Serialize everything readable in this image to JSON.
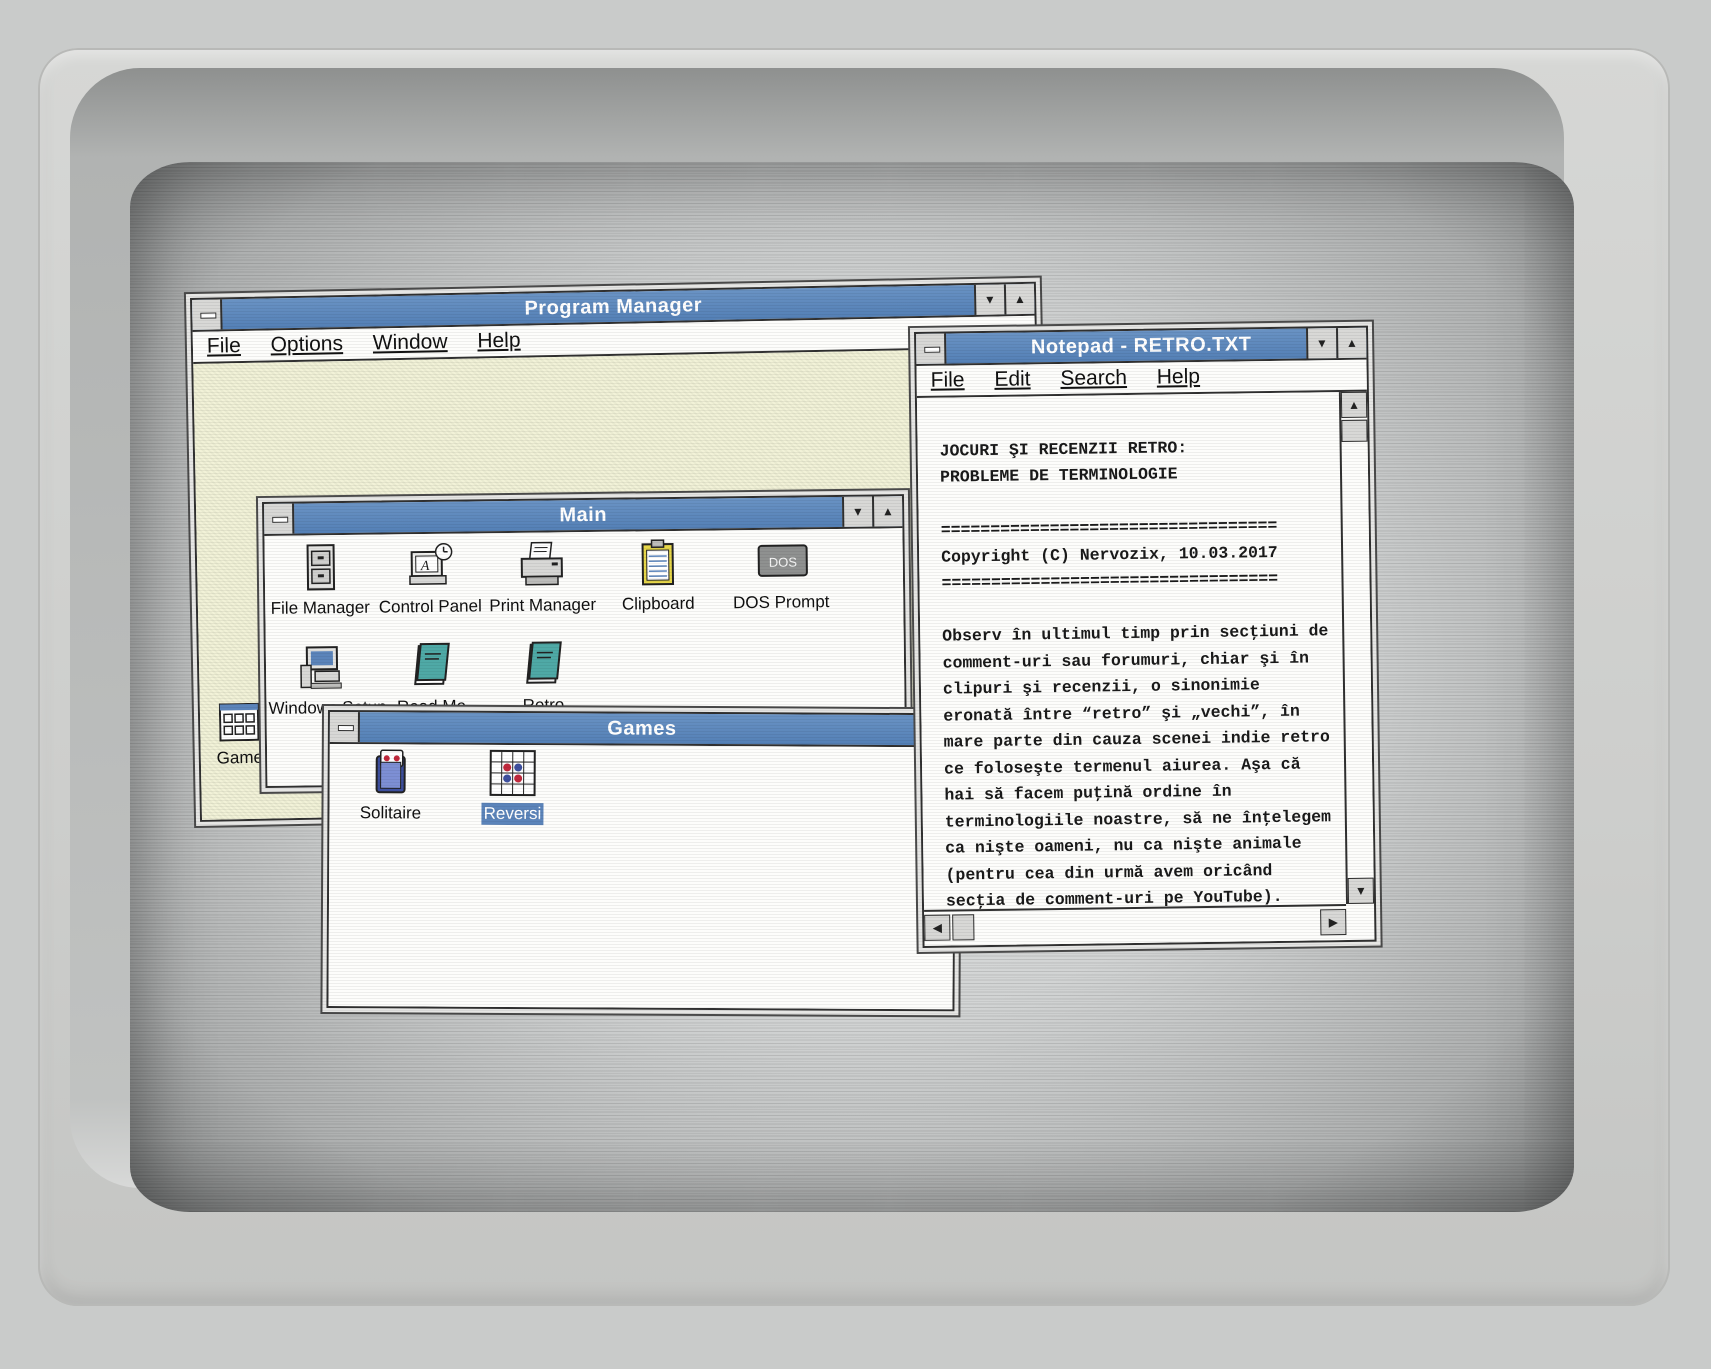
{
  "program_manager": {
    "title": "Program Manager",
    "menu": [
      "File",
      "Options",
      "Window",
      "Help"
    ],
    "minimized_group_label": "Game"
  },
  "main_group": {
    "title": "Main",
    "icons": [
      {
        "label": "File Manager",
        "icon": "file-cabinet-icon"
      },
      {
        "label": "Control Panel",
        "icon": "control-panel-icon"
      },
      {
        "label": "Print Manager",
        "icon": "printer-icon"
      },
      {
        "label": "Clipboard",
        "icon": "clipboard-icon"
      },
      {
        "label": "DOS Prompt",
        "icon": "dos-prompt-icon"
      },
      {
        "label": "Windows Setup",
        "icon": "windows-setup-icon"
      },
      {
        "label": "Read Me",
        "icon": "notepad-icon"
      },
      {
        "label": "Retro",
        "icon": "notepad-icon"
      }
    ],
    "dos_icon_text": "DOS"
  },
  "games_group": {
    "title": "Games",
    "icons": [
      {
        "label": "Solitaire",
        "icon": "solitaire-icon"
      },
      {
        "label": "Reversi",
        "icon": "reversi-icon",
        "selected": true
      }
    ]
  },
  "notepad": {
    "title": "Notepad - RETRO.TXT",
    "menu": [
      "File",
      "Edit",
      "Search",
      "Help"
    ],
    "lines": [
      "JOCURI ŞI RECENZII RETRO:",
      "PROBLEME DE TERMINOLOGIE",
      "",
      "==================================",
      "Copyright (C) Nervozix, 10.03.2017",
      "==================================",
      "",
      "Observ în ultimul timp prin secţiuni de",
      "comment-uri sau forumuri, chiar şi în",
      "clipuri şi recenzii, o sinonimie",
      "eronată între “retro” şi „vechi”, în",
      "mare parte din cauza scenei indie retro",
      "ce foloseşte termenul aiurea. Aşa că",
      "hai să facem puţină ordine în",
      "terminologiile noastre, să ne înţelegem",
      "ca nişte oameni, nu ca nişte animale",
      "(pentru cea din urmă avem oricând",
      "secţia de comment-uri pe YouTube)."
    ]
  },
  "colors": {
    "titlebar": "#5b84ba",
    "selection": "#5b84ba",
    "window_bg": "#fdfdfb",
    "desktop_bg": "#efefd4"
  }
}
